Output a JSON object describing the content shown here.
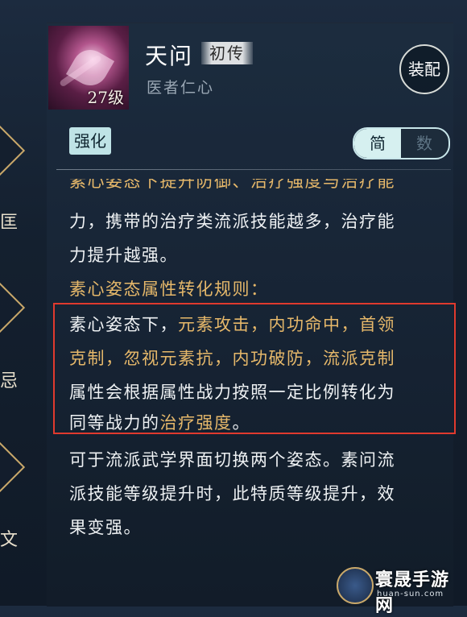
{
  "left_nav": {
    "labels": [
      "匡",
      "忌",
      "文"
    ]
  },
  "skill": {
    "name": "天问",
    "tier": "初传",
    "subtitle": "医者仁心",
    "level": "27级"
  },
  "buttons": {
    "equip": "装配",
    "enhance": "强化"
  },
  "view_toggle": {
    "simple": "简",
    "numeric": "数",
    "selected": "简"
  },
  "description": {
    "clipped_top": "素心姿态下提升防御、治疗强度与治疗能",
    "para1_line1": "力，携带的治疗类流派技能越多，治疗能",
    "para1_line2": "力提升越强。",
    "rule_title": "素心姿态属性转化规则：",
    "rule_l1_a": "素心姿态下，",
    "rule_l1_b": "元素攻击，内功命中，首领",
    "rule_l2": "克制，忽视元素抗，内功破防，流派克制",
    "rule_l3": "属性会根据属性战力按照一定比例转化为",
    "rule_l4_a": "同等战力的",
    "rule_l4_b": "治疗强度",
    "rule_l4_c": "。",
    "para3_line1": "可于流派武学界面切换两个姿态。素问流",
    "para3_line2": "派技能等级提升时，此特质等级提升，效",
    "para3_line3": "果变强。"
  },
  "watermark": {
    "name": "寰晟手游网",
    "url": "huan-sun.com"
  },
  "colors": {
    "accent_gold": "#e6b86a",
    "highlight_red": "#e03a2e",
    "enhance_bg": "#bfe3e6"
  }
}
